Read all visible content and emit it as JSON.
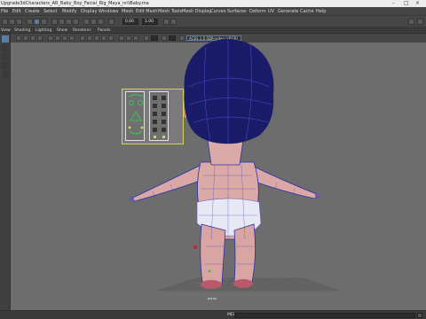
{
  "window": {
    "title": "Upgrade3dCharacters_AR_Baby_Boy_Facial_Rig_Maya_nri\\Baby.ma"
  },
  "menubar": {
    "items": [
      "File",
      "Edit",
      "Create",
      "Select",
      "Modify",
      "Display",
      "Windows",
      "Mesh",
      "Edit Mesh",
      "Mesh Tools",
      "Mesh Display",
      "Curves",
      "Surfaces",
      "Deform",
      "UV",
      "Generate",
      "Cache",
      "Help"
    ]
  },
  "statusline": {
    "field1": "0.00",
    "field2": "1.00"
  },
  "shelf": {
    "tabs": [
      "View",
      "Shading",
      "Lighting",
      "Show",
      "Renderer",
      "Panels"
    ]
  },
  "viewport": {
    "resolution_gate": "ACES 1.0 SDR-video (sRGB)",
    "camera_label": "persp"
  },
  "helpline": {
    "mel_label": "MEL"
  },
  "colors": {
    "accent": "#5b7fa4",
    "viewport_bg": "#6d6d6d",
    "wireframe": "#2a2fa8",
    "picker_outline": "#d8d04f",
    "control_green": "#3fbf5a"
  },
  "icons": [
    "minimize-icon",
    "maximize-icon",
    "close-icon",
    "select-tool-icon",
    "move-tool-icon",
    "rotate-tool-icon",
    "scale-tool-icon"
  ]
}
